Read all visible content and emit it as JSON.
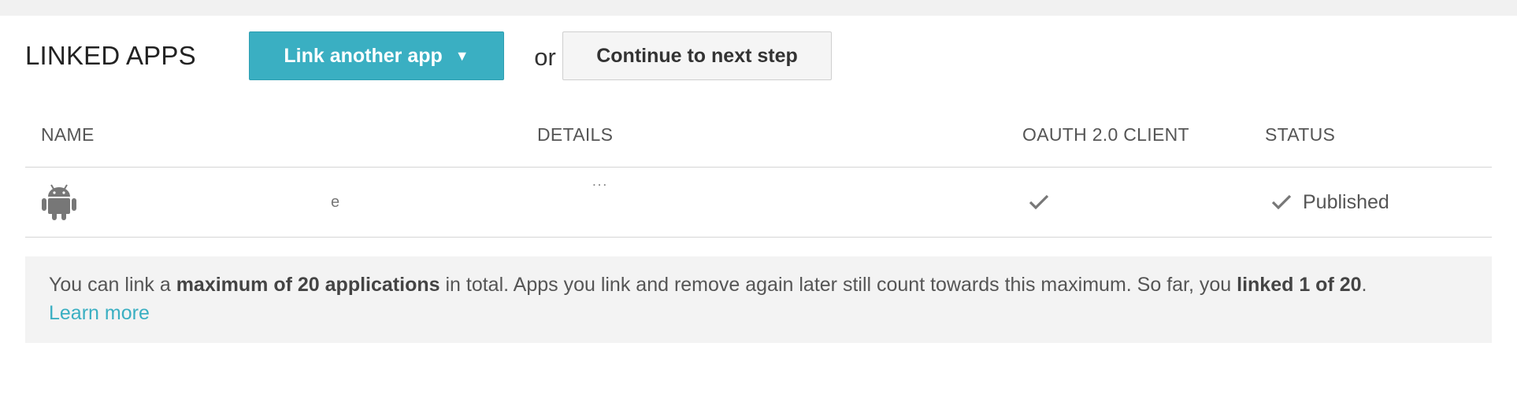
{
  "header": {
    "title": "LINKED APPS",
    "link_button_label": "Link another app",
    "link_button_caret": "▼",
    "or_text": "or",
    "continue_button_label": "Continue to next step"
  },
  "table": {
    "columns": {
      "name": "NAME",
      "details": "DETAILS",
      "oauth": "OAUTH 2.0 CLIENT",
      "status": "STATUS"
    },
    "rows": [
      {
        "platform_icon": "android-icon",
        "name_fragment": "e",
        "details_fragment": "˙˙˙",
        "oauth_icon": "check-icon",
        "status_icon": "check-icon",
        "status": "Published"
      }
    ]
  },
  "notice": {
    "text_1": "You can link a ",
    "bold_1": "maximum of 20 applications",
    "text_2": " in total. Apps you link and remove again later still count towards this maximum. So far, you ",
    "bold_2": "linked 1 of 20",
    "text_3": ".",
    "learn_more": "Learn more"
  },
  "colors": {
    "accent": "#3aafc2",
    "notice_bg": "#f3f3f3",
    "top_strip": "#f1f1f1"
  }
}
